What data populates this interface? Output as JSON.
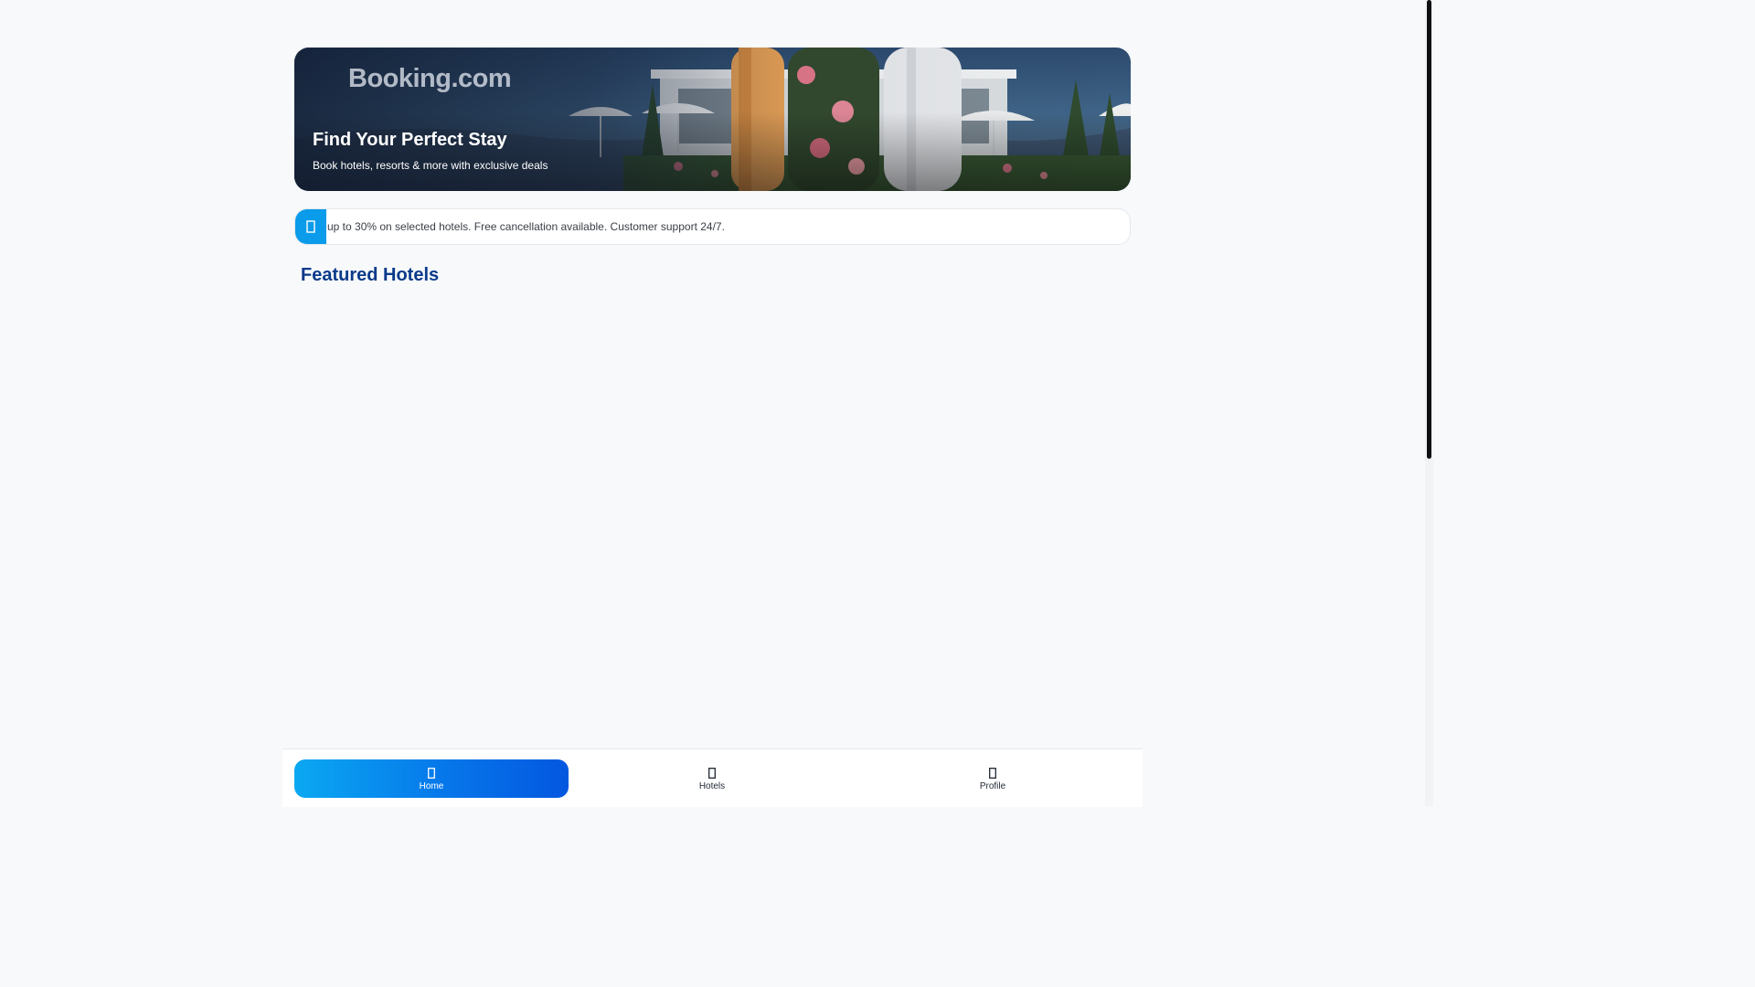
{
  "hero": {
    "logo_text": "Booking.com",
    "title": "Find Your Perfect Stay",
    "subtitle": "Book hotels, resorts & more with exclusive deals"
  },
  "notice": {
    "icon": "info-icon",
    "text": "up to 30% on selected hotels. Free cancellation available. Customer support 24/7."
  },
  "featured": {
    "title": "Featured Hotels"
  },
  "bottom_nav": {
    "items": [
      {
        "label": "Home",
        "icon": "home-icon",
        "active": true
      },
      {
        "label": "Hotels",
        "icon": "hotel-icon",
        "active": false
      },
      {
        "label": "Profile",
        "icon": "user-icon",
        "active": false
      }
    ]
  },
  "colors": {
    "accent": "#0a9bea",
    "nav_active_start": "#0aa8f2",
    "nav_active_end": "#0457e0",
    "section_title": "#0a3a8a",
    "background": "#f7f9fb"
  }
}
